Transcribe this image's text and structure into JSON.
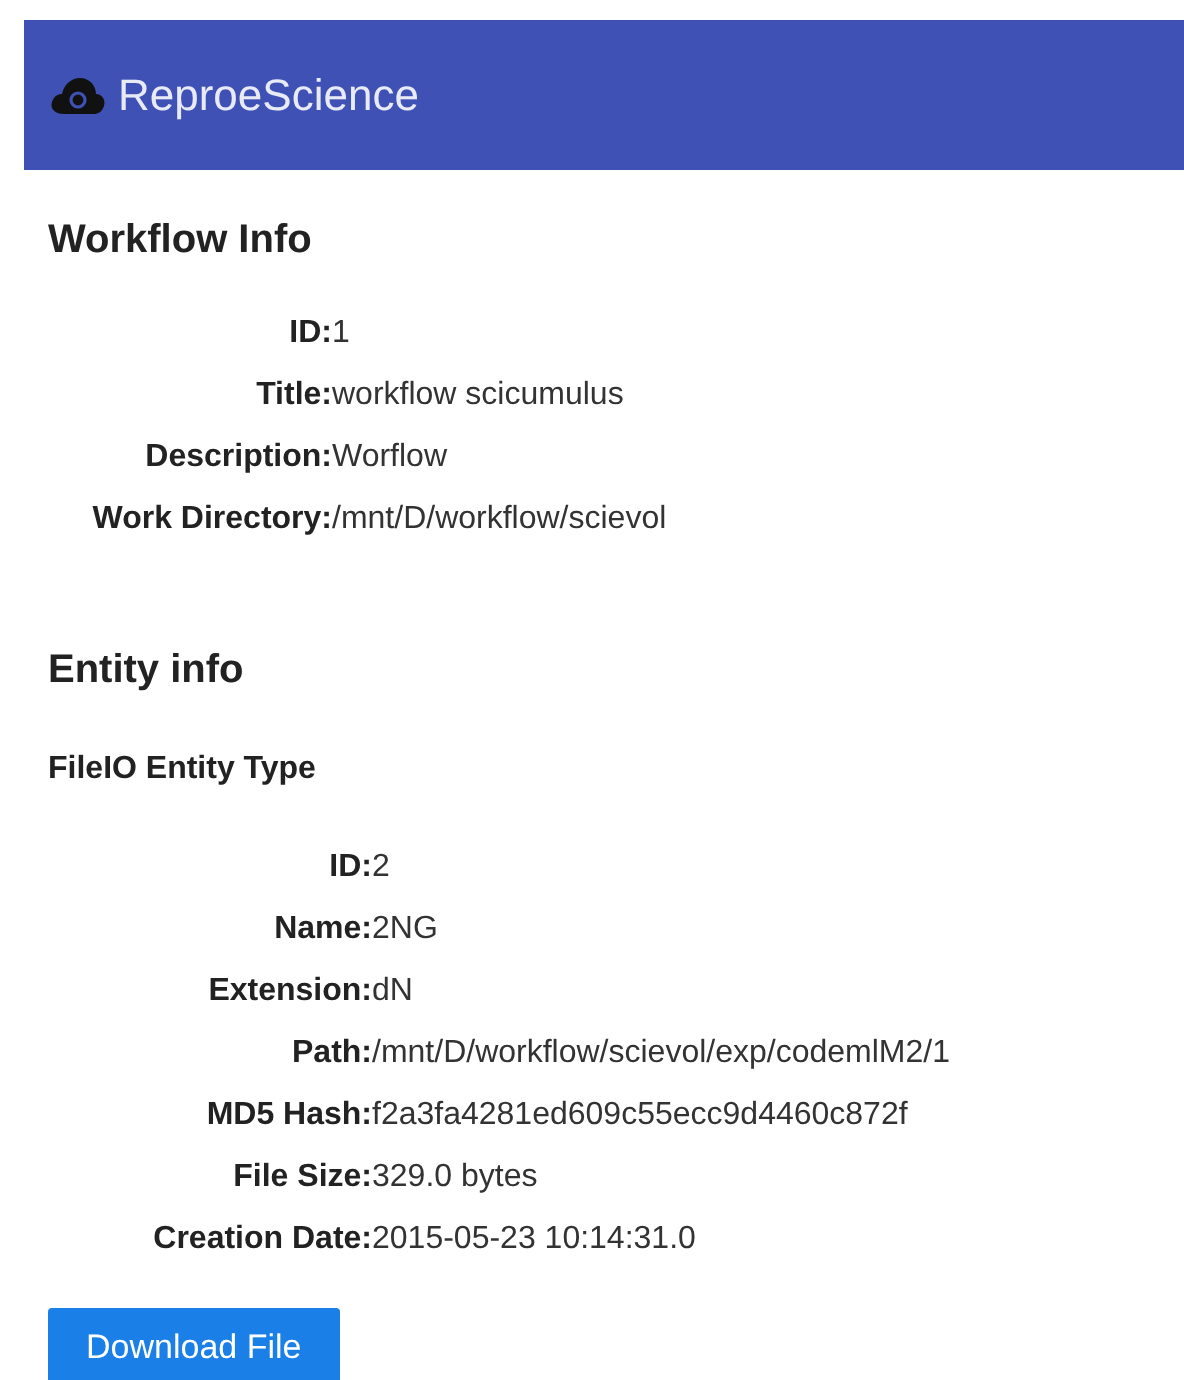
{
  "app_bar": {
    "title": "ReproeScience"
  },
  "workflow_info": {
    "heading": "Workflow Info",
    "fields": [
      {
        "label": "ID:",
        "value": "1"
      },
      {
        "label": "Title:",
        "value": "workflow scicumulus"
      },
      {
        "label": "Description:",
        "value": "Worflow"
      },
      {
        "label": "Work Directory:",
        "value": "/mnt/D/workflow/scievol"
      }
    ]
  },
  "entity_info": {
    "heading": "Entity info",
    "subheading": "FileIO Entity Type",
    "fields": [
      {
        "label": "ID:",
        "value": "2"
      },
      {
        "label": "Name:",
        "value": "2NG"
      },
      {
        "label": "Extension:",
        "value": "dN"
      },
      {
        "label": "Path:",
        "value": "/mnt/D/workflow/scievol/exp/codemlM2/1"
      },
      {
        "label": "MD5 Hash:",
        "value": "f2a3fa4281ed609c55ecc9d4460c872f"
      },
      {
        "label": "File Size:",
        "value": "329.0 bytes"
      },
      {
        "label": "Creation Date:",
        "value": "2015-05-23 10:14:31.0"
      }
    ]
  },
  "download_button": "Download File"
}
